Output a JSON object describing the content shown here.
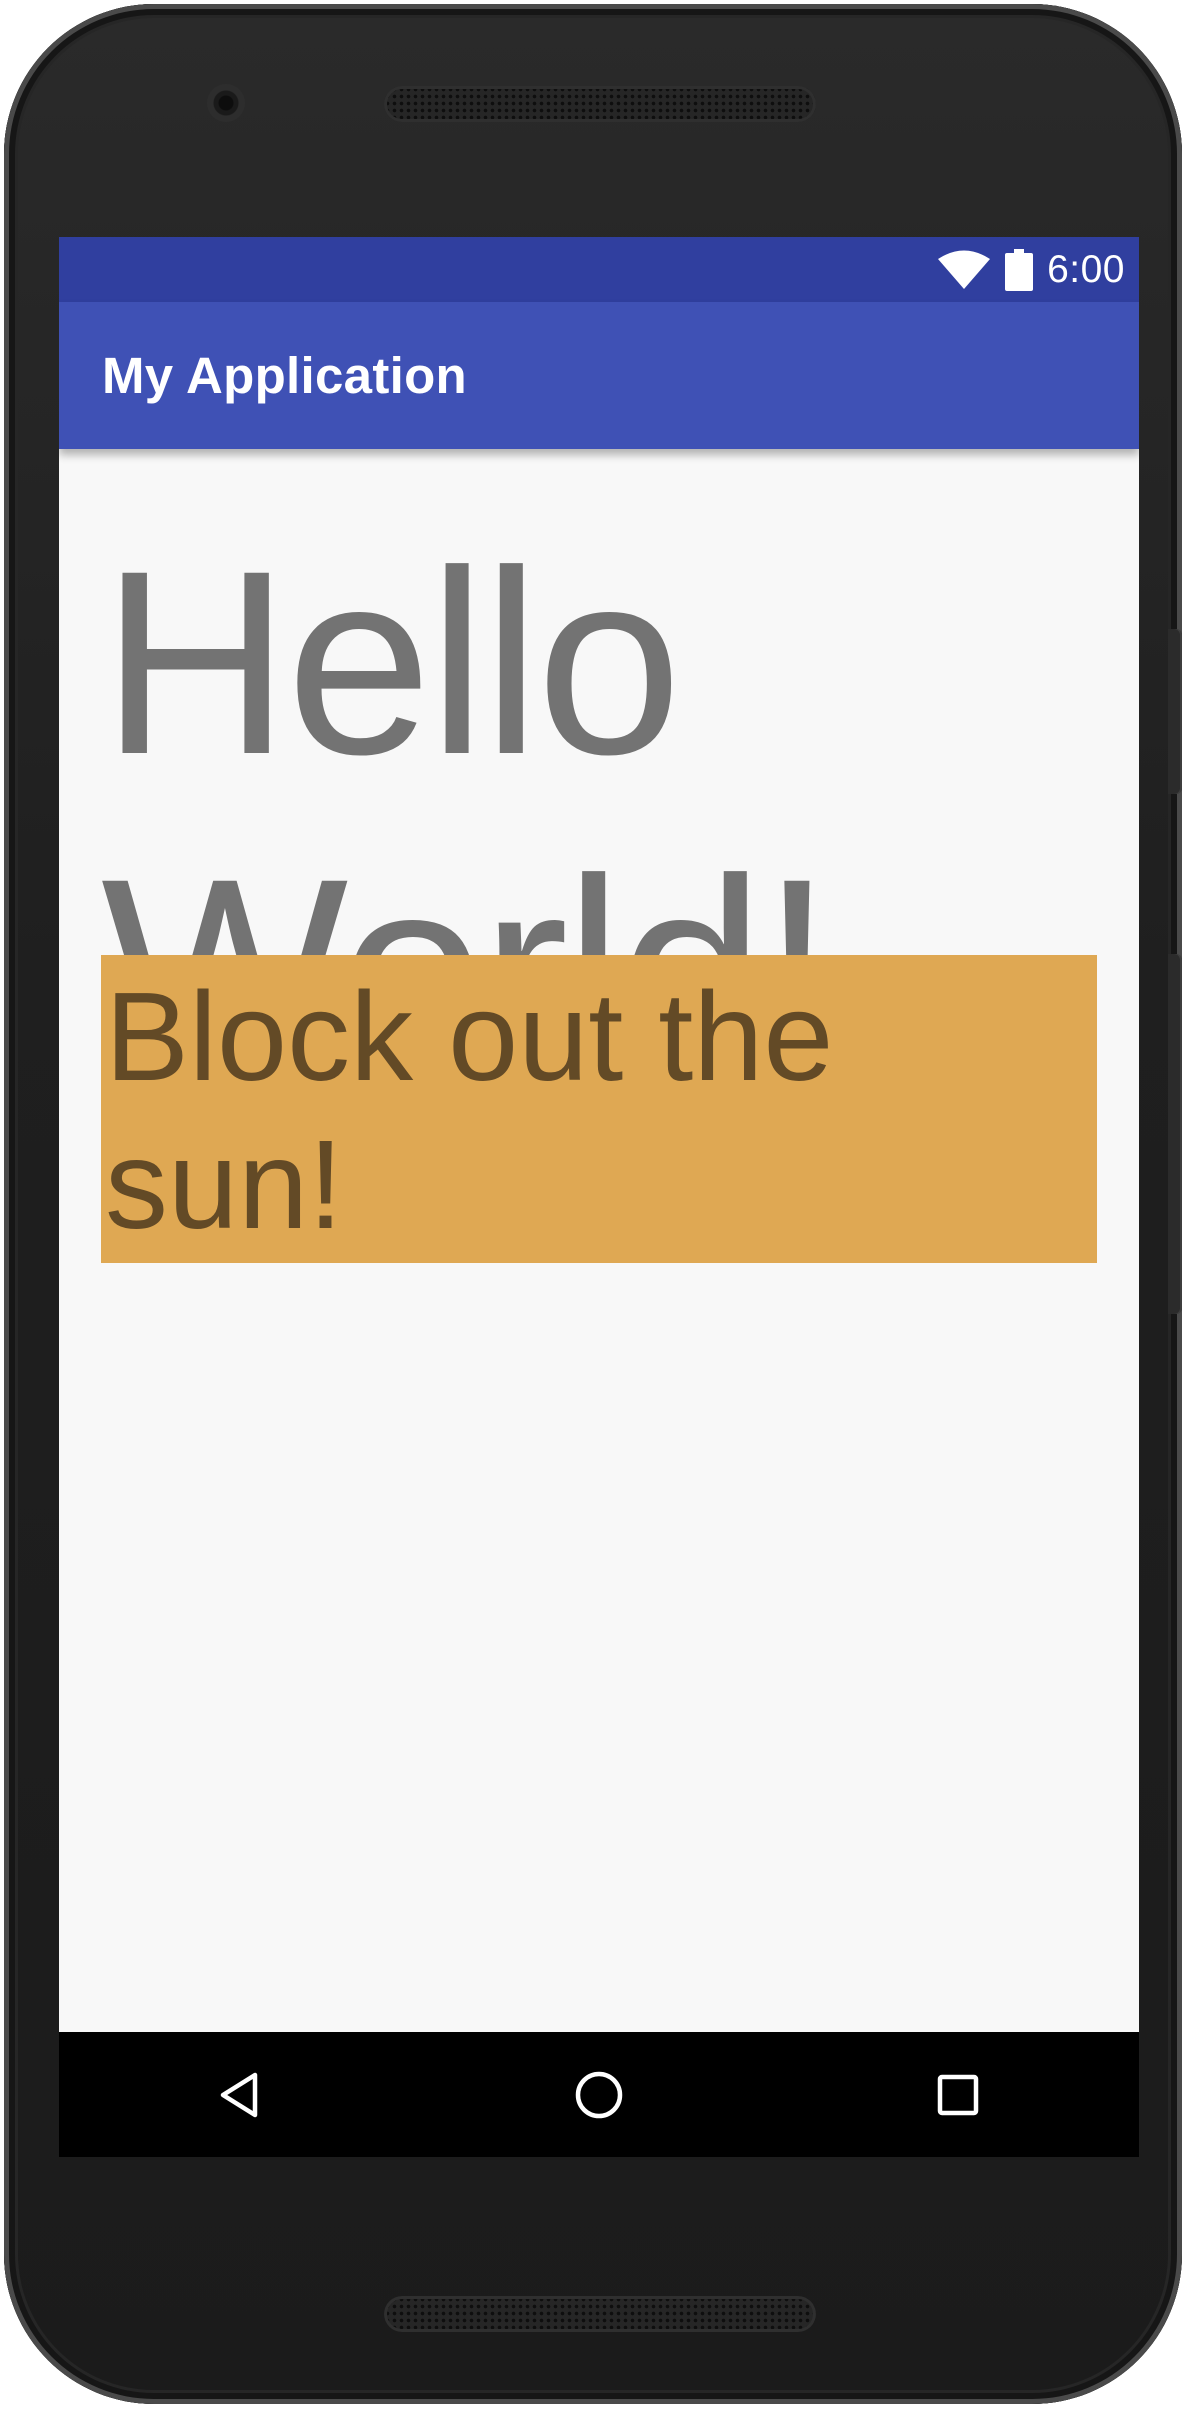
{
  "status_bar": {
    "time": "6:00",
    "icons": [
      "wifi-icon",
      "battery-icon"
    ]
  },
  "app_bar": {
    "title": "My Application"
  },
  "content": {
    "hello_text": "Hello World!",
    "sun_text": "Block out the sun!"
  },
  "nav_bar": {
    "buttons": [
      "back-icon",
      "home-icon",
      "recents-icon"
    ]
  },
  "colors": {
    "status_bar": "#303f9f",
    "app_bar": "#3f51b5",
    "background": "#f8f8f8",
    "hello_text": "#737373",
    "sun_box": "#dfa853",
    "sun_text": "#634a26",
    "nav_bar": "#000000"
  }
}
